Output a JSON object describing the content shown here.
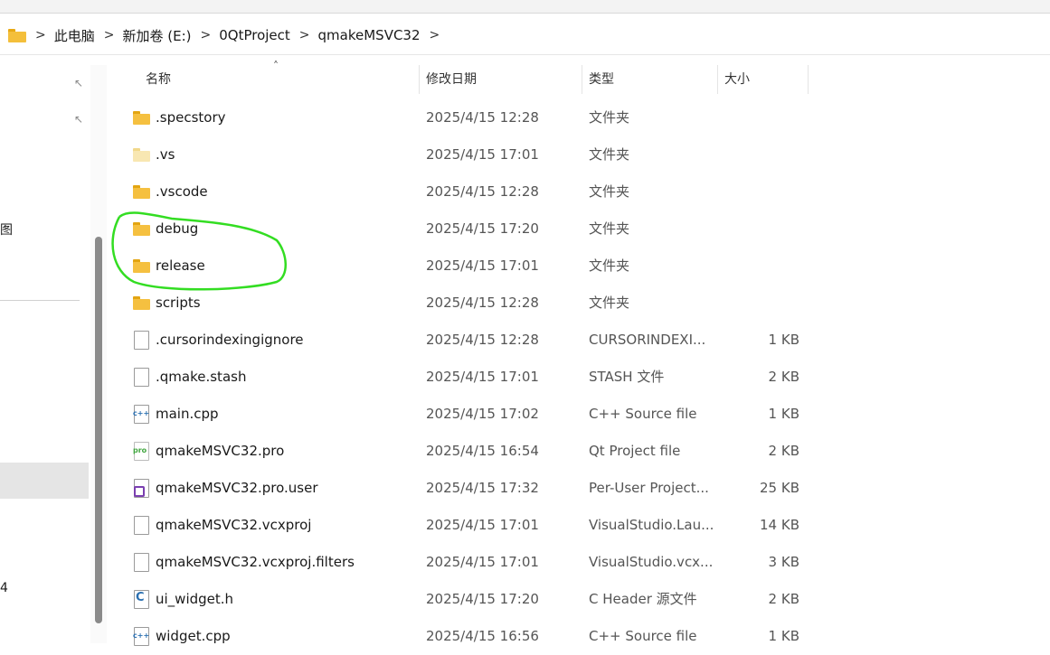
{
  "window": {
    "breadcrumb": [
      "此电脑",
      "新加卷 (E:)",
      "0QtProject",
      "qmakeMSVC32"
    ]
  },
  "nav": {
    "partial_label_1": "图",
    "partial_label_2": "4"
  },
  "columns": {
    "name": "名称",
    "date": "修改日期",
    "type": "类型",
    "size": "大小"
  },
  "files": [
    {
      "name": ".specstory",
      "date": "2025/4/15 12:28",
      "type": "文件夹",
      "size": "",
      "icon": "folder-icon"
    },
    {
      "name": ".vs",
      "date": "2025/4/15 17:01",
      "type": "文件夹",
      "size": "",
      "icon": "folder-icon-hidden"
    },
    {
      "name": ".vscode",
      "date": "2025/4/15 12:28",
      "type": "文件夹",
      "size": "",
      "icon": "folder-icon"
    },
    {
      "name": "debug",
      "date": "2025/4/15 17:20",
      "type": "文件夹",
      "size": "",
      "icon": "folder-icon"
    },
    {
      "name": "release",
      "date": "2025/4/15 17:01",
      "type": "文件夹",
      "size": "",
      "icon": "folder-icon"
    },
    {
      "name": "scripts",
      "date": "2025/4/15 12:28",
      "type": "文件夹",
      "size": "",
      "icon": "folder-icon"
    },
    {
      "name": ".cursorindexingignore",
      "date": "2025/4/15 12:28",
      "type": "CURSORINDEXI...",
      "size": "1 KB",
      "icon": "file-icon"
    },
    {
      "name": ".qmake.stash",
      "date": "2025/4/15 17:01",
      "type": "STASH 文件",
      "size": "2 KB",
      "icon": "file-icon"
    },
    {
      "name": "main.cpp",
      "date": "2025/4/15 17:02",
      "type": "C++ Source file",
      "size": "1 KB",
      "icon": "cpp-file-icon"
    },
    {
      "name": "qmakeMSVC32.pro",
      "date": "2025/4/15 16:54",
      "type": "Qt Project file",
      "size": "2 KB",
      "icon": "pro-file-icon"
    },
    {
      "name": "qmakeMSVC32.pro.user",
      "date": "2025/4/15 17:32",
      "type": "Per-User Project...",
      "size": "25 KB",
      "icon": "vs-file-icon"
    },
    {
      "name": "qmakeMSVC32.vcxproj",
      "date": "2025/4/15 17:01",
      "type": "VisualStudio.Lau...",
      "size": "14 KB",
      "icon": "file-icon"
    },
    {
      "name": "qmakeMSVC32.vcxproj.filters",
      "date": "2025/4/15 17:01",
      "type": "VisualStudio.vcx...",
      "size": "3 KB",
      "icon": "file-icon"
    },
    {
      "name": "ui_widget.h",
      "date": "2025/4/15 17:20",
      "type": "C Header 源文件",
      "size": "2 KB",
      "icon": "h-file-icon"
    },
    {
      "name": "widget.cpp",
      "date": "2025/4/15 16:56",
      "type": "C++ Source file",
      "size": "1 KB",
      "icon": "cpp-file-icon"
    }
  ],
  "annotation": {
    "color": "#33dd22"
  }
}
